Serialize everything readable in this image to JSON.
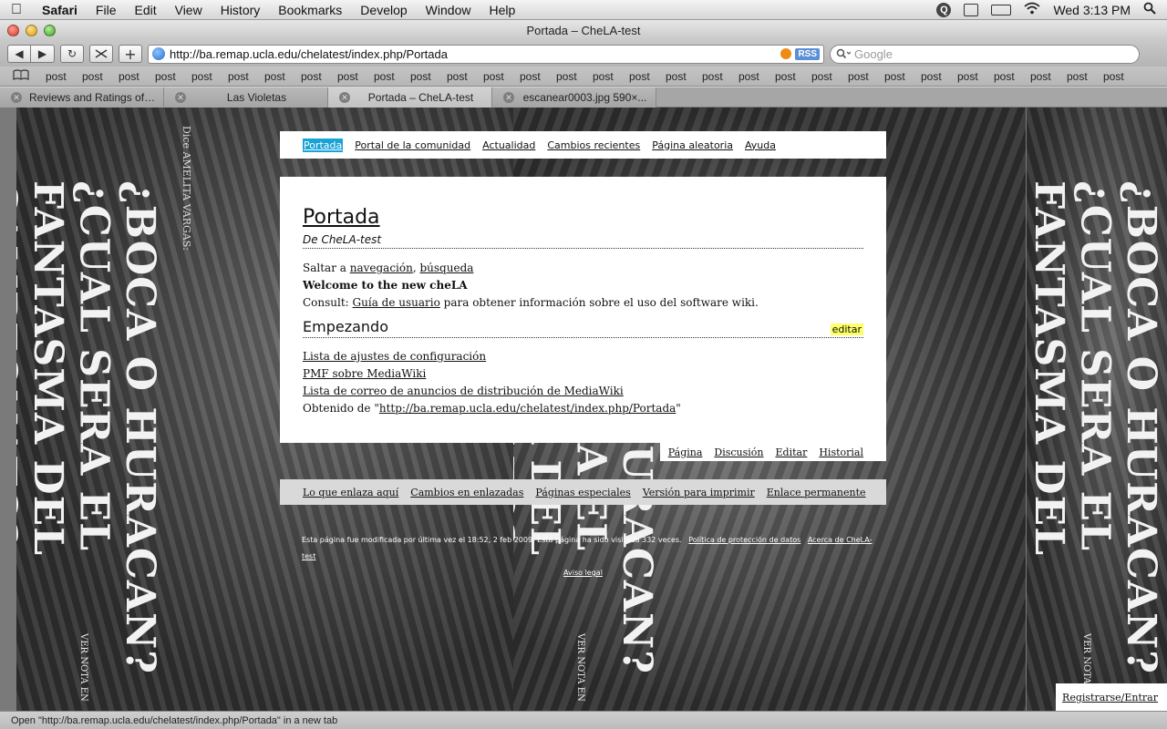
{
  "menubar": {
    "items": [
      "Safari",
      "File",
      "Edit",
      "View",
      "History",
      "Bookmarks",
      "Develop",
      "Window",
      "Help"
    ],
    "clock": "Wed 3:13 PM"
  },
  "window": {
    "title": "Portada – CheLA-test"
  },
  "toolbar": {
    "url": "http://ba.remap.ucla.edu/chelatest/index.php/Portada",
    "rss_label": "RSS",
    "search_placeholder": "Google",
    "add_label": "+"
  },
  "bookmarks": [
    "post",
    "post",
    "post",
    "post",
    "post",
    "post",
    "post",
    "post",
    "post",
    "post",
    "post",
    "post",
    "post",
    "post",
    "post",
    "post",
    "post",
    "post",
    "post",
    "post",
    "post",
    "post",
    "post",
    "post",
    "post",
    "post",
    "post",
    "post",
    "post",
    "post"
  ],
  "tabs": [
    {
      "label": "Reviews and Ratings of ...",
      "active": false
    },
    {
      "label": "Las Violetas",
      "active": false
    },
    {
      "label": "Portada – CheLA-test",
      "active": true
    },
    {
      "label": "escanear0003.jpg 590×...",
      "active": false
    }
  ],
  "poster": {
    "headline": "¿BOCA O HURACAN? ¿CUAL SERA EL FANTASMA DEL CAMPEONATO?",
    "side_text": "Dice AMELITA VARGAS:",
    "footer_text": "VER NOTA EN"
  },
  "wiki": {
    "nav": [
      "Portada",
      "Portal de la comunidad",
      "Actualidad",
      "Cambios recientes",
      "Página aleatoria",
      "Ayuda"
    ],
    "title": "Portada",
    "from": "De CheLA-test",
    "jump_prefix": "Saltar a ",
    "jump_nav": "navegación",
    "jump_sep": ", ",
    "jump_search": "búsqueda",
    "welcome": "Welcome to the new cheLA",
    "consult_prefix": "Consult: ",
    "consult_link": "Guía de usuario",
    "consult_suffix": " para obtener información sobre el uso del software wiki.",
    "section_title": "Empezando",
    "edit_label": "editar",
    "links": [
      "Lista de ajustes de configuración",
      "PMF sobre MediaWiki",
      "Lista de correo de anuncios de distribución de MediaWiki"
    ],
    "obtained_prefix": "Obtenido de \"",
    "obtained_link": "http://ba.remap.ucla.edu/chelatest/index.php/Portada",
    "obtained_suffix": "\"",
    "page_tabs": [
      "Página",
      "Discusión",
      "Editar",
      "Historial"
    ],
    "tools": [
      "Lo que enlaza aquí",
      "Cambios en enlazadas",
      "Páginas especiales",
      "Versión para imprimir",
      "Enlace permanente"
    ],
    "footer_text": "Esta página fue modificada por última vez el 18:52, 2 feb 2009. Esta página ha sido visitada 332 veces.",
    "footer_links": [
      "Política de protección de datos",
      "Acerca de CheLA-test",
      "Aviso legal"
    ],
    "login": "Registrarse/Entrar"
  },
  "statusbar": {
    "text": "Open \"http://ba.remap.ucla.edu/chelatest/index.php/Portada\" in a new tab"
  }
}
